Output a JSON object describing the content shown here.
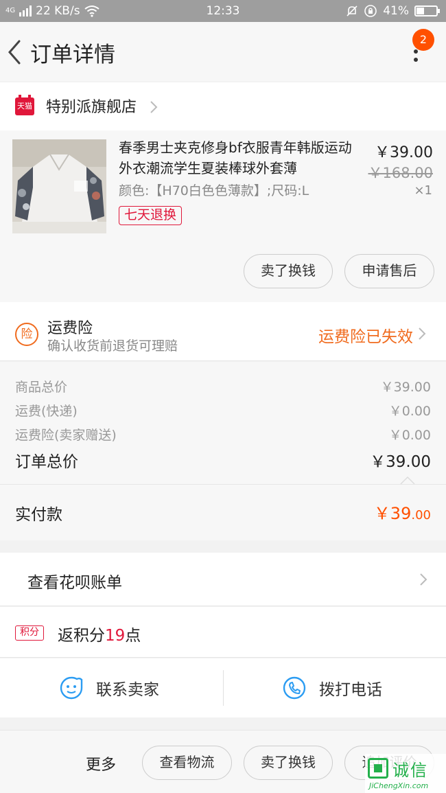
{
  "status_bar": {
    "network_tag": "4G",
    "speed": "22 KB/s",
    "time": "12:33",
    "battery": "41%",
    "battery_level": 0.41
  },
  "nav": {
    "title": "订单详情",
    "badge_count": "2"
  },
  "shop": {
    "brand_badge": "天猫",
    "name": "特别派旗舰店"
  },
  "product": {
    "title": "春季男士夹克修身bf衣服青年韩版运动外衣潮流学生夏装棒球外套薄",
    "spec": "颜色:【H70白色色薄款】;尺码:L",
    "tag": "七天退换",
    "price": "￥39.00",
    "original_price": "￥168.00",
    "quantity": "×1",
    "buttons": {
      "sell": "卖了换钱",
      "after_sale": "申请售后"
    }
  },
  "insurance": {
    "icon_label": "险",
    "title": "运费险",
    "subtitle": "确认收货前退货可理赔",
    "status": "运费险已失效"
  },
  "summary": {
    "rows": [
      {
        "label": "商品总价",
        "value": "￥39.00"
      },
      {
        "label": "运费(快递)",
        "value": "￥0.00"
      },
      {
        "label": "运费险(卖家赠送)",
        "value": "￥0.00"
      }
    ],
    "total_label": "订单总价",
    "total_value": "￥39.00",
    "paid_label": "实付款",
    "paid_main": "￥39",
    "paid_decimal": ".00"
  },
  "huabei": {
    "label": "查看花呗账单"
  },
  "points": {
    "tag": "积分",
    "prefix": "返积分",
    "number": "19",
    "suffix": "点"
  },
  "contact": {
    "seller": "联系卖家",
    "phone": "拨打电话"
  },
  "bottom_bar": {
    "more": "更多",
    "buttons": [
      "查看物流",
      "卖了换钱",
      "追加评价"
    ]
  },
  "watermark": {
    "cn": "诚信",
    "en": "JiChengXin.com"
  },
  "colors": {
    "accent_orange": "#ff5000",
    "tmall_red": "#e0173a",
    "insurance_orange": "#f06b1e",
    "icon_blue": "#2b9cf2"
  }
}
